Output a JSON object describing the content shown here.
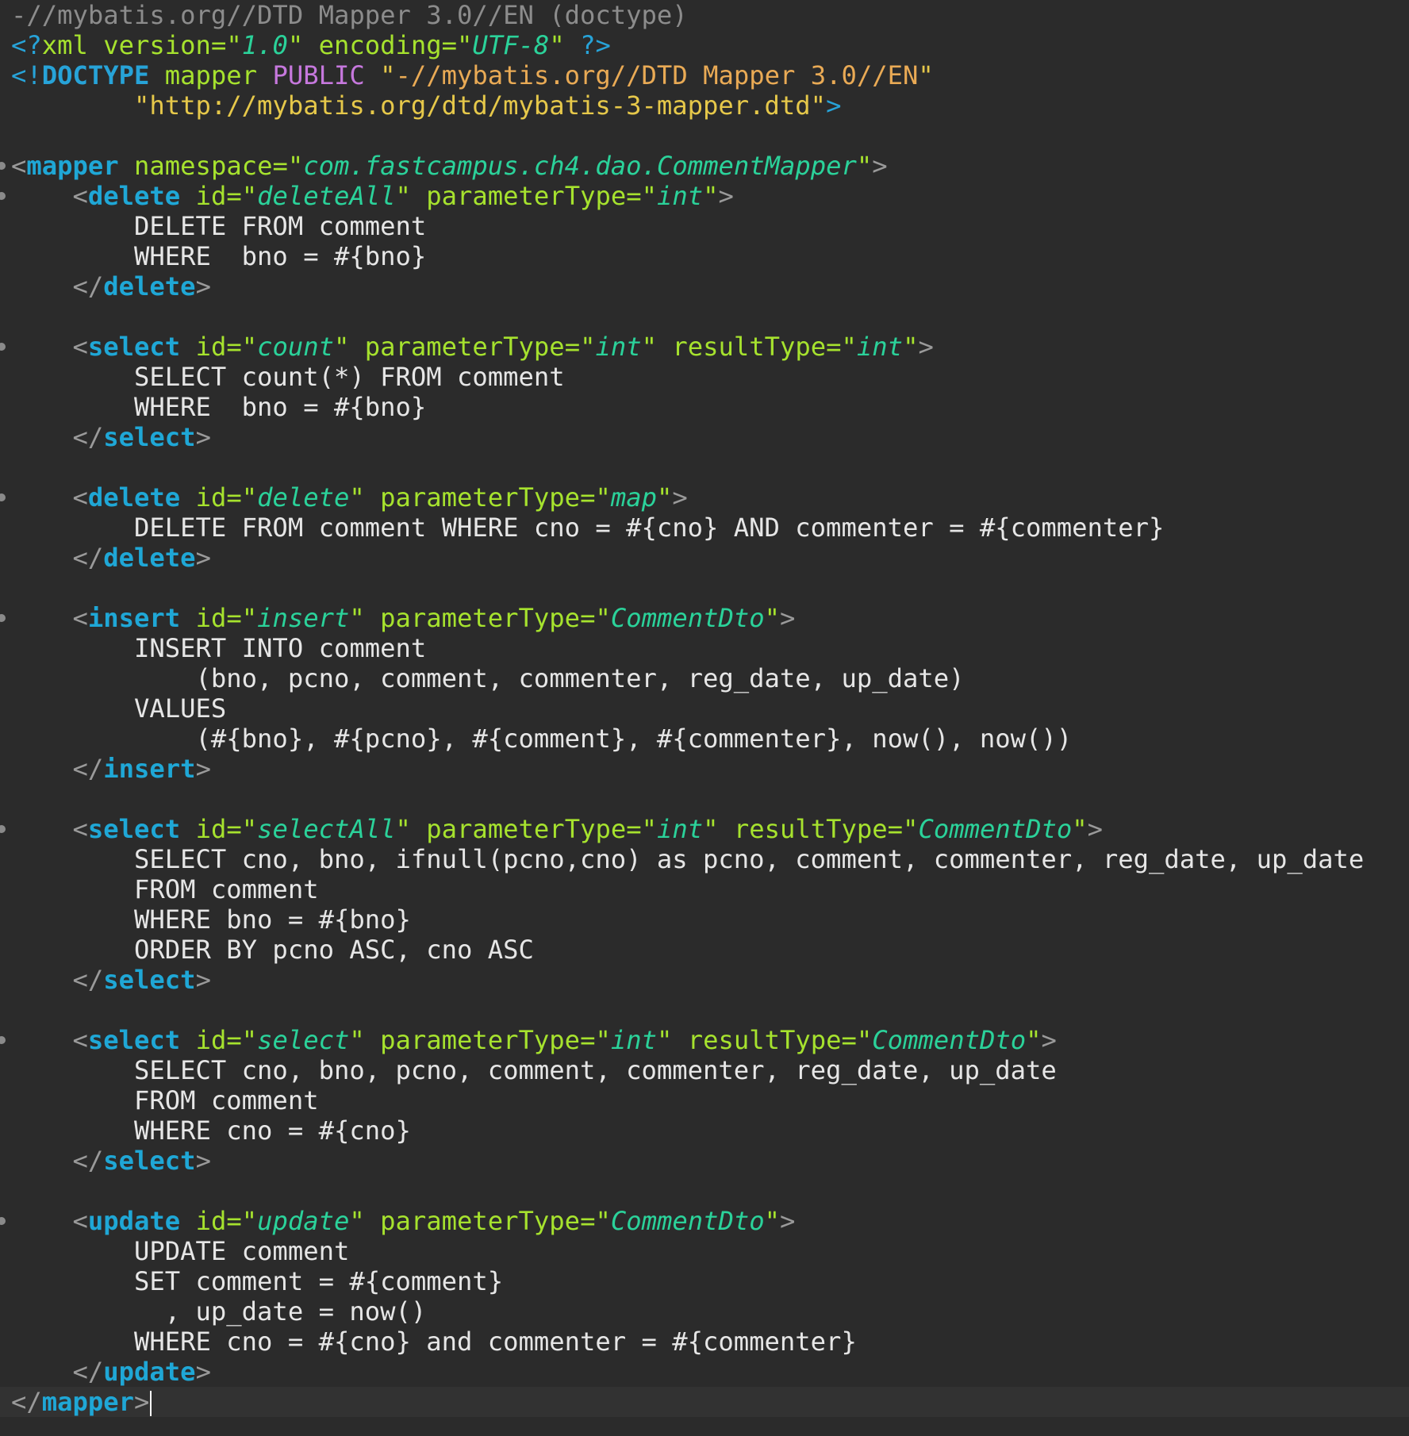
{
  "editor": {
    "language": "xml",
    "lines": [
      {
        "segments": [
          [
            "c-hdr",
            "-//mybatis.org//DTD Mapper 3.0//EN (doctype)"
          ]
        ]
      },
      {
        "segments": [
          [
            "c-pi",
            "<?"
          ],
          [
            "c-attr",
            "xml "
          ],
          [
            "c-attr",
            "version"
          ],
          [
            "c-q",
            "=\""
          ],
          [
            "c-val",
            "1.0"
          ],
          [
            "c-q",
            "\" "
          ],
          [
            "c-attr",
            "encoding"
          ],
          [
            "c-q",
            "=\""
          ],
          [
            "c-val",
            "UTF-8"
          ],
          [
            "c-q",
            "\" "
          ],
          [
            "c-pi",
            "?>"
          ]
        ]
      },
      {
        "segments": [
          [
            "c-pi",
            "<!"
          ],
          [
            "c-dt",
            "DOCTYPE "
          ],
          [
            "c-attr",
            "mapper "
          ],
          [
            "c-kw",
            "PUBLIC "
          ],
          [
            "c-str",
            "\""
          ],
          [
            "c-vstr",
            "-//mybatis.org//DTD Mapper 3.0//EN"
          ],
          [
            "c-str",
            "\""
          ]
        ]
      },
      {
        "segments": [
          [
            "c-text",
            "        "
          ],
          [
            "c-str",
            "\"http://mybatis.org/dtd/mybatis-3-mapper.dtd\""
          ],
          [
            "c-pi",
            ">"
          ]
        ]
      },
      {
        "segments": []
      },
      {
        "fold": true,
        "segments": [
          [
            "c-punc",
            "<"
          ],
          [
            "c-tag",
            "mapper "
          ],
          [
            "c-attr",
            "namespace"
          ],
          [
            "c-q",
            "=\""
          ],
          [
            "c-val",
            "com.fastcampus.ch4.dao.CommentMapper"
          ],
          [
            "c-q",
            "\""
          ],
          [
            "c-punc",
            ">"
          ]
        ]
      },
      {
        "fold": true,
        "segments": [
          [
            "c-text",
            "    "
          ],
          [
            "c-punc",
            "<"
          ],
          [
            "c-tag",
            "delete "
          ],
          [
            "c-attr",
            "id"
          ],
          [
            "c-q",
            "=\""
          ],
          [
            "c-val",
            "deleteAll"
          ],
          [
            "c-q",
            "\" "
          ],
          [
            "c-attr",
            "parameterType"
          ],
          [
            "c-q",
            "=\""
          ],
          [
            "c-val",
            "int"
          ],
          [
            "c-q",
            "\""
          ],
          [
            "c-punc",
            ">"
          ]
        ]
      },
      {
        "segments": [
          [
            "c-text",
            "        DELETE FROM comment"
          ]
        ]
      },
      {
        "segments": [
          [
            "c-text",
            "        WHERE  bno = #{bno}"
          ]
        ]
      },
      {
        "segments": [
          [
            "c-text",
            "    "
          ],
          [
            "c-punc",
            "</"
          ],
          [
            "c-tag",
            "delete"
          ],
          [
            "c-punc",
            ">"
          ]
        ]
      },
      {
        "segments": []
      },
      {
        "fold": true,
        "segments": [
          [
            "c-text",
            "    "
          ],
          [
            "c-punc",
            "<"
          ],
          [
            "c-tag",
            "select "
          ],
          [
            "c-attr",
            "id"
          ],
          [
            "c-q",
            "=\""
          ],
          [
            "c-val",
            "count"
          ],
          [
            "c-q",
            "\" "
          ],
          [
            "c-attr",
            "parameterType"
          ],
          [
            "c-q",
            "=\""
          ],
          [
            "c-val",
            "int"
          ],
          [
            "c-q",
            "\" "
          ],
          [
            "c-attr",
            "resultType"
          ],
          [
            "c-q",
            "=\""
          ],
          [
            "c-val",
            "int"
          ],
          [
            "c-q",
            "\""
          ],
          [
            "c-punc",
            ">"
          ]
        ]
      },
      {
        "segments": [
          [
            "c-text",
            "        SELECT count(*) FROM comment"
          ]
        ]
      },
      {
        "segments": [
          [
            "c-text",
            "        WHERE  bno = #{bno}"
          ]
        ]
      },
      {
        "segments": [
          [
            "c-text",
            "    "
          ],
          [
            "c-punc",
            "</"
          ],
          [
            "c-tag",
            "select"
          ],
          [
            "c-punc",
            ">"
          ]
        ]
      },
      {
        "segments": []
      },
      {
        "fold": true,
        "segments": [
          [
            "c-text",
            "    "
          ],
          [
            "c-punc",
            "<"
          ],
          [
            "c-tag",
            "delete "
          ],
          [
            "c-attr",
            "id"
          ],
          [
            "c-q",
            "=\""
          ],
          [
            "c-val",
            "delete"
          ],
          [
            "c-q",
            "\" "
          ],
          [
            "c-attr",
            "parameterType"
          ],
          [
            "c-q",
            "=\""
          ],
          [
            "c-val",
            "map"
          ],
          [
            "c-q",
            "\""
          ],
          [
            "c-punc",
            ">"
          ]
        ]
      },
      {
        "segments": [
          [
            "c-text",
            "        DELETE FROM comment WHERE cno = #{cno} AND commenter = #{commenter}"
          ]
        ]
      },
      {
        "segments": [
          [
            "c-text",
            "    "
          ],
          [
            "c-punc",
            "</"
          ],
          [
            "c-tag",
            "delete"
          ],
          [
            "c-punc",
            ">"
          ]
        ]
      },
      {
        "segments": []
      },
      {
        "fold": true,
        "segments": [
          [
            "c-text",
            "    "
          ],
          [
            "c-punc",
            "<"
          ],
          [
            "c-tag",
            "insert "
          ],
          [
            "c-attr",
            "id"
          ],
          [
            "c-q",
            "=\""
          ],
          [
            "c-val",
            "insert"
          ],
          [
            "c-q",
            "\" "
          ],
          [
            "c-attr",
            "parameterType"
          ],
          [
            "c-q",
            "=\""
          ],
          [
            "c-val",
            "CommentDto"
          ],
          [
            "c-q",
            "\""
          ],
          [
            "c-punc",
            ">"
          ]
        ]
      },
      {
        "segments": [
          [
            "c-text",
            "        INSERT INTO comment"
          ]
        ]
      },
      {
        "segments": [
          [
            "c-text",
            "            (bno, pcno, comment, commenter, reg_date, up_date)"
          ]
        ]
      },
      {
        "segments": [
          [
            "c-text",
            "        VALUES"
          ]
        ]
      },
      {
        "segments": [
          [
            "c-text",
            "            (#{bno}, #{pcno}, #{comment}, #{commenter}, now(), now())"
          ]
        ]
      },
      {
        "segments": [
          [
            "c-text",
            "    "
          ],
          [
            "c-punc",
            "</"
          ],
          [
            "c-tag",
            "insert"
          ],
          [
            "c-punc",
            ">"
          ]
        ]
      },
      {
        "segments": []
      },
      {
        "fold": true,
        "segments": [
          [
            "c-text",
            "    "
          ],
          [
            "c-punc",
            "<"
          ],
          [
            "c-tag",
            "select "
          ],
          [
            "c-attr",
            "id"
          ],
          [
            "c-q",
            "=\""
          ],
          [
            "c-val",
            "selectAll"
          ],
          [
            "c-q",
            "\" "
          ],
          [
            "c-attr",
            "parameterType"
          ],
          [
            "c-q",
            "=\""
          ],
          [
            "c-val",
            "int"
          ],
          [
            "c-q",
            "\" "
          ],
          [
            "c-attr",
            "resultType"
          ],
          [
            "c-q",
            "=\""
          ],
          [
            "c-val",
            "CommentDto"
          ],
          [
            "c-q",
            "\""
          ],
          [
            "c-punc",
            ">"
          ]
        ]
      },
      {
        "segments": [
          [
            "c-text",
            "        SELECT cno, bno, ifnull(pcno,cno) as pcno, comment, commenter, reg_date, up_date"
          ]
        ]
      },
      {
        "segments": [
          [
            "c-text",
            "        FROM comment"
          ]
        ]
      },
      {
        "segments": [
          [
            "c-text",
            "        WHERE bno = #{bno}"
          ]
        ]
      },
      {
        "segments": [
          [
            "c-text",
            "        ORDER BY pcno ASC, cno ASC"
          ]
        ]
      },
      {
        "segments": [
          [
            "c-text",
            "    "
          ],
          [
            "c-punc",
            "</"
          ],
          [
            "c-tag",
            "select"
          ],
          [
            "c-punc",
            ">"
          ]
        ]
      },
      {
        "segments": []
      },
      {
        "fold": true,
        "segments": [
          [
            "c-text",
            "    "
          ],
          [
            "c-punc",
            "<"
          ],
          [
            "c-tag",
            "select "
          ],
          [
            "c-attr",
            "id"
          ],
          [
            "c-q",
            "=\""
          ],
          [
            "c-val",
            "select"
          ],
          [
            "c-q",
            "\" "
          ],
          [
            "c-attr",
            "parameterType"
          ],
          [
            "c-q",
            "=\""
          ],
          [
            "c-val",
            "int"
          ],
          [
            "c-q",
            "\" "
          ],
          [
            "c-attr",
            "resultType"
          ],
          [
            "c-q",
            "=\""
          ],
          [
            "c-val",
            "CommentDto"
          ],
          [
            "c-q",
            "\""
          ],
          [
            "c-punc",
            ">"
          ]
        ]
      },
      {
        "segments": [
          [
            "c-text",
            "        SELECT cno, bno, pcno, comment, commenter, reg_date, up_date"
          ]
        ]
      },
      {
        "segments": [
          [
            "c-text",
            "        FROM comment"
          ]
        ]
      },
      {
        "segments": [
          [
            "c-text",
            "        WHERE cno = #{cno}"
          ]
        ]
      },
      {
        "segments": [
          [
            "c-text",
            "    "
          ],
          [
            "c-punc",
            "</"
          ],
          [
            "c-tag",
            "select"
          ],
          [
            "c-punc",
            ">"
          ]
        ]
      },
      {
        "segments": []
      },
      {
        "fold": true,
        "segments": [
          [
            "c-text",
            "    "
          ],
          [
            "c-punc",
            "<"
          ],
          [
            "c-tag",
            "update "
          ],
          [
            "c-attr",
            "id"
          ],
          [
            "c-q",
            "=\""
          ],
          [
            "c-val",
            "update"
          ],
          [
            "c-q",
            "\" "
          ],
          [
            "c-attr",
            "parameterType"
          ],
          [
            "c-q",
            "=\""
          ],
          [
            "c-val",
            "CommentDto"
          ],
          [
            "c-q",
            "\""
          ],
          [
            "c-punc",
            ">"
          ]
        ]
      },
      {
        "segments": [
          [
            "c-text",
            "        UPDATE comment"
          ]
        ]
      },
      {
        "segments": [
          [
            "c-text",
            "        SET comment = #{comment}"
          ]
        ]
      },
      {
        "segments": [
          [
            "c-text",
            "          , up_date = now()"
          ]
        ]
      },
      {
        "segments": [
          [
            "c-text",
            "        WHERE cno = #{cno} and commenter = #{commenter}"
          ]
        ]
      },
      {
        "segments": [
          [
            "c-text",
            "    "
          ],
          [
            "c-punc",
            "</"
          ],
          [
            "c-tag",
            "update"
          ],
          [
            "c-punc",
            ">"
          ]
        ]
      },
      {
        "current": true,
        "cursor": true,
        "segments": [
          [
            "c-punc",
            "</"
          ],
          [
            "c-tag",
            "mapper"
          ],
          [
            "c-punc",
            ">"
          ]
        ]
      }
    ]
  }
}
